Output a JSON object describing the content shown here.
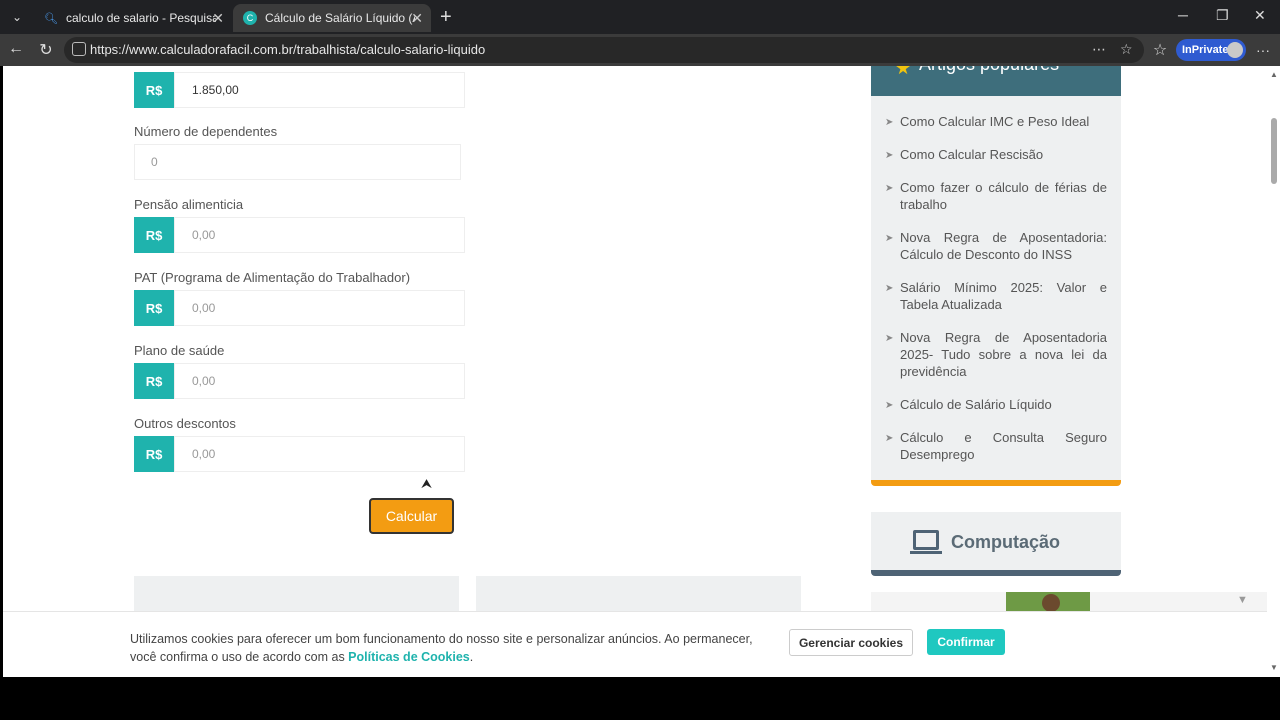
{
  "browser": {
    "tabs": [
      {
        "title": "calculo de salario - Pesquisar"
      },
      {
        "title": "Cálculo de Salário Líquido (Atualiz"
      }
    ],
    "url": "https://www.calculadorafacil.com.br/trabalhista/calculo-salario-liquido",
    "inprivate_label": "InPrivate"
  },
  "form": {
    "currency": "R$",
    "salary_value": "1.850,00",
    "dependents_label": "Número de dependentes",
    "dependents_placeholder": "0",
    "alimony_label": "Pensão alimenticia",
    "alimony_placeholder": "0,00",
    "pat_label": "PAT (Programa de Alimentação do Trabalhador)",
    "pat_placeholder": "0,00",
    "health_label": "Plano de saúde",
    "health_placeholder": "0,00",
    "other_label": "Outros descontos",
    "other_placeholder": "0,00",
    "calculate_label": "Calcular"
  },
  "sidebar": {
    "popular_title": "Artigos populares",
    "items": [
      "Como Calcular IMC e Peso Ideal",
      "Como Calcular Rescisão",
      "Como fazer o cálculo de férias de trabalho",
      "Nova Regra de Aposentadoria: Cálculo de Desconto do INSS",
      "Salário Mínimo 2025: Valor e Tabela Atualizada",
      "Nova Regra de Aposentadoria 2025- Tudo sobre a nova lei da previdência",
      "Cálculo de Salário Líquido",
      "Cálculo e Consulta Seguro Desemprego"
    ],
    "computing_title": "Computação"
  },
  "cookie": {
    "text": "Utilizamos cookies para oferecer um bom funcionamento do nosso site e personalizar anúncios. Ao permanecer, você confirma o uso de acordo com as ",
    "link": "Políticas de Cookies",
    "end": ".",
    "manage_label": "Gerenciar cookies",
    "confirm_label": "Confirmar"
  },
  "colors": {
    "accent": "#1fb3ad",
    "button": "#f39c12",
    "sidebar_header": "#3e6e7c"
  }
}
